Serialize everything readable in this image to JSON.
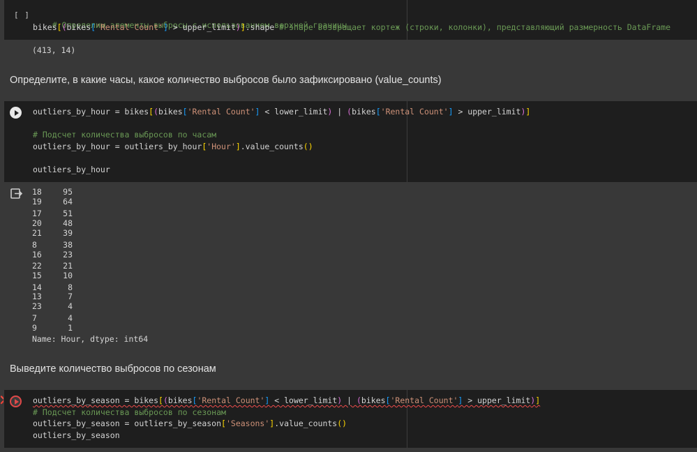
{
  "cell1": {
    "bracket": "[ ]",
    "comment": "# Определим элементы-выбросы с использованием верхней границы",
    "line2_code_a": "bikes",
    "line2_code_b": "bikes",
    "line2_str": "'Rental Count'",
    "line2_code_c": " > upper_limit",
    "line2_code_d": ".shape ",
    "line2_comment": "# shape возвращает кортеж (строки, колонки), представляющий размерность DataFrame",
    "output": "(413, 14)"
  },
  "markdown1": "Определите, в какие часы, какое количество выбросов было зафиксировано (value_counts)",
  "cell2": {
    "line1_a": "outliers_by_hour = bikes",
    "line1_b": "bikes",
    "line1_str1": "'Rental Count'",
    "line1_c": " < lower_limit",
    "line1_d": " | ",
    "line1_e": "bikes",
    "line1_str2": "'Rental Count'",
    "line1_f": " > upper_limit",
    "comment": "# Подсчет количества выбросов по часам",
    "line3_a": "outliers_by_hour = outliers_by_hour",
    "line3_str": "'Hour'",
    "line3_b": ".value_counts",
    "line4": "outliers_by_hour"
  },
  "output2": {
    "rows": [
      {
        "k": "18",
        "v": "95"
      },
      {
        "k": "19",
        "v": "64"
      },
      {
        "k": "17",
        "v": "51"
      },
      {
        "k": "20",
        "v": "48"
      },
      {
        "k": "21",
        "v": "39"
      },
      {
        "k": "8",
        "v": "38"
      },
      {
        "k": "16",
        "v": "23"
      },
      {
        "k": "22",
        "v": "21"
      },
      {
        "k": "15",
        "v": "10"
      },
      {
        "k": "14",
        "v": "8"
      },
      {
        "k": "13",
        "v": "7"
      },
      {
        "k": "23",
        "v": "4"
      },
      {
        "k": "7",
        "v": "4"
      },
      {
        "k": "9",
        "v": "1"
      }
    ],
    "footer": "Name: Hour, dtype: int64"
  },
  "markdown2": "Выведите количество выбросов по сезонам",
  "cell3": {
    "line1_a": "outliers_by_season = bikes",
    "line1_b": "bikes",
    "line1_str1": "'Rental Count'",
    "line1_c": " < lower_limit",
    "line1_d": " | ",
    "line1_e": "bikes",
    "line1_str2": "'Rental Count'",
    "line1_f": " > upper_limit",
    "comment": "# Подсчет количества выбросов по сезонам",
    "line3_a": "outliers_by_season = outliers_by_season",
    "line3_str": "'Seasons'",
    "line3_b": ".value_counts",
    "line4": "outliers_by_season"
  },
  "colors": {
    "comment": "#6a9955",
    "string": "#ce9178",
    "bracket_gold": "#ffd700",
    "bracket_purple": "#da70d6",
    "bracket_blue": "#179fff",
    "error": "#e04848"
  }
}
